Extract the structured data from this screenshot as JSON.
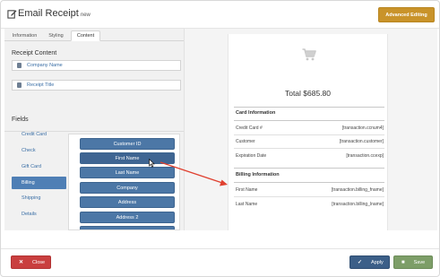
{
  "header": {
    "title": "Email Receipt",
    "badge": "new",
    "advanced_label": "Advanced Editing"
  },
  "tabs": [
    {
      "label": "Information"
    },
    {
      "label": "Styling"
    },
    {
      "label": "Content"
    }
  ],
  "receipt_content": {
    "heading": "Receipt Content",
    "inputs": [
      {
        "value": "Company Name",
        "icon": "building-icon"
      },
      {
        "value": "Receipt Title",
        "icon": "document-icon"
      }
    ]
  },
  "fields": {
    "heading": "Fields",
    "nav": [
      {
        "label": "Credit Card"
      },
      {
        "label": "Check"
      },
      {
        "label": "Gift Card"
      },
      {
        "label": "Billing"
      },
      {
        "label": "Shipping"
      },
      {
        "label": "Details"
      }
    ],
    "palette": [
      {
        "label": "Customer ID"
      },
      {
        "label": "First Name"
      },
      {
        "label": "Last Name"
      },
      {
        "label": "Company"
      },
      {
        "label": "Address"
      },
      {
        "label": "Address 2"
      }
    ]
  },
  "preview": {
    "total": "Total $685.80",
    "card_title": "Card Information",
    "card_rows": [
      {
        "label": "Credit Card #",
        "value": "[transaction.ccnum4]"
      },
      {
        "label": "Customer",
        "value": "[transaction.customer]"
      },
      {
        "label": "Expiration Date",
        "value": "[transaction.ccexp]"
      }
    ],
    "billing_title": "Billing Information",
    "billing_rows": [
      {
        "label": "First Name",
        "value": "[transaction.billing_fname]"
      },
      {
        "label": "Last Name",
        "value": "[transaction.billing_lname]"
      }
    ]
  },
  "footer": {
    "close_label": "Close",
    "apply_label": "Apply",
    "save_label": "Save"
  },
  "colors": {
    "advanced": "#c9932a",
    "close": "#c93f3f",
    "apply": "#3c5f88",
    "save": "#7d9e68",
    "field_button": "#4c77a6",
    "arrow": "#e0402f"
  }
}
